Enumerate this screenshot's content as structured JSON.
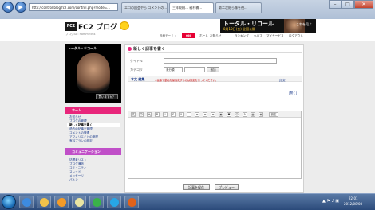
{
  "browser": {
    "address": "http://control.blog.fc2.com/control.php?mode=...",
    "tabs": [
      {
        "label": "エロの国会やら コメントの..."
      },
      {
        "label": "三年較橋… 親村橋…"
      },
      {
        "label": "第二次貼ら像を視..."
      }
    ],
    "window_controls": {
      "minimize": "–",
      "maximize": "□",
      "close": "✕"
    }
  },
  "header": {
    "logo_badge": "FC2",
    "logo_text": "FC2 ブログ",
    "blog_id": "ブログID : homme564",
    "status_label": "投稿モード :",
    "status_value": "ON",
    "links": [
      "ホーム",
      "お知らせ",
      "ランキング",
      "ヘルプ",
      "マイサービス",
      "ログアウト"
    ]
  },
  "ad_banner": {
    "title": "トータル・リコール",
    "subtitle": "8月10日(金) 全国公開",
    "tag": "これを見よ"
  },
  "left_ad": {
    "title": "トータル・リコール",
    "button": "買いますか？"
  },
  "sidebar": {
    "home_heading": "ホーム",
    "home_items": [
      {
        "label": "お知らせ"
      },
      {
        "label": "ブログの管理"
      },
      {
        "label": "新しく記事を書く"
      },
      {
        "label": "過去の記事を管理"
      },
      {
        "label": "コメントの管理"
      },
      {
        "label": "アフィリエイトの管理"
      },
      {
        "label": "有料プランの設定"
      }
    ],
    "community_heading": "コミュニケーション",
    "community_items": [
      {
        "label": "訪問者リスト"
      },
      {
        "label": "ブログ通信"
      },
      {
        "label": "コミュニティ"
      },
      {
        "label": "スレッド"
      },
      {
        "label": "メッセージ"
      },
      {
        "label": "バトン"
      }
    ]
  },
  "editor": {
    "heading": "新しく記事を書く",
    "title_label": "タイトル",
    "category_label": "カテゴリ",
    "category_value": "未分類",
    "add_label": "追加",
    "body_label": "本文",
    "body_label_2": "編集",
    "body_note": "※画像や動画を最適化するには設定を行ってください。",
    "body_note_link": "[設定]",
    "collapse_label": "[開く]",
    "toolbar": [
      "文",
      "中",
      "大",
      "B",
      "I",
      "S",
      "U",
      "—",
      "≡",
      "≡",
      "≡",
      "▣",
      "♥",
      "☺",
      "✎",
      "▦",
      "◉"
    ],
    "settings_label": "設定",
    "save_label": "記事を保存",
    "preview_label": "プレビュー"
  },
  "taskbar": {
    "time": "22:01",
    "date": "2012/08/08",
    "tray": "▲ ⚑ ♪ ▣",
    "apps": [
      {
        "name": "ie-icon",
        "color": "#3d8be0"
      },
      {
        "name": "explorer-icon",
        "color": "#f0c24b"
      },
      {
        "name": "media-icon",
        "color": "#f39b28"
      },
      {
        "name": "security-icon",
        "color": "#e8e4a2"
      },
      {
        "name": "chat-icon",
        "color": "#3ab24a"
      },
      {
        "name": "skype-icon",
        "color": "#27a6e6"
      },
      {
        "name": "firefox-icon",
        "color": "#e0621b"
      }
    ]
  }
}
